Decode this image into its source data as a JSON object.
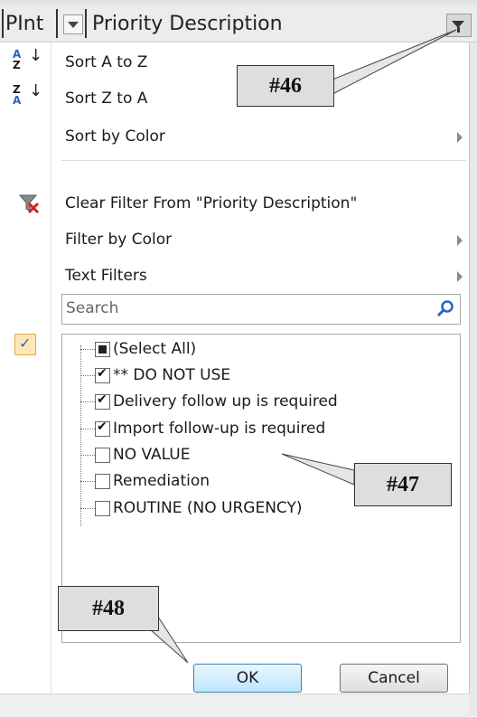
{
  "header": {
    "col1_label": "PInt",
    "col2_label": "Priority Description"
  },
  "menu": {
    "sort_az": "Sort A to Z",
    "sort_za": "Sort Z to A",
    "sort_by_color": "Sort by Color",
    "clear_filter": "Clear Filter From \"Priority Description\"",
    "filter_by_color": "Filter by Color",
    "text_filters": "Text Filters"
  },
  "search": {
    "placeholder": "Search"
  },
  "list": {
    "items": [
      {
        "label": "(Select All)",
        "state": "partial"
      },
      {
        "label": "** DO NOT USE",
        "state": "checked"
      },
      {
        "label": "Delivery follow up is required",
        "state": "checked"
      },
      {
        "label": "Import follow-up is required",
        "state": "checked"
      },
      {
        "label": "NO VALUE",
        "state": "unchecked"
      },
      {
        "label": "Remediation",
        "state": "unchecked"
      },
      {
        "label": "ROUTINE (NO URGENCY)",
        "state": "unchecked"
      }
    ]
  },
  "buttons": {
    "ok": "OK",
    "cancel": "Cancel"
  },
  "callouts": {
    "c46": "#46",
    "c47": "#47",
    "c48": "#48"
  },
  "colors": {
    "accent_blue": "#2a63c4",
    "checkbox_highlight": "#fde7b6"
  }
}
